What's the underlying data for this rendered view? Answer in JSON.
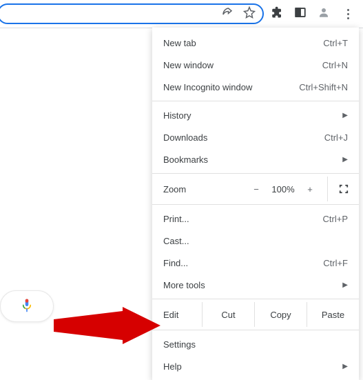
{
  "toolbar": {
    "share_icon": "share-icon",
    "star_icon": "star-icon",
    "ext_icon": "extensions-icon",
    "panel_icon": "side-panel-icon",
    "profile_icon": "profile-icon",
    "menu_icon": "kebab-menu-icon"
  },
  "menu": {
    "newTab": {
      "label": "New tab",
      "shortcut": "Ctrl+T"
    },
    "newWindow": {
      "label": "New window",
      "shortcut": "Ctrl+N"
    },
    "incognito": {
      "label": "New Incognito window",
      "shortcut": "Ctrl+Shift+N"
    },
    "history": {
      "label": "History"
    },
    "downloads": {
      "label": "Downloads",
      "shortcut": "Ctrl+J"
    },
    "bookmarks": {
      "label": "Bookmarks"
    },
    "zoom": {
      "label": "Zoom",
      "minus": "−",
      "value": "100%",
      "plus": "+"
    },
    "print": {
      "label": "Print...",
      "shortcut": "Ctrl+P"
    },
    "cast": {
      "label": "Cast..."
    },
    "find": {
      "label": "Find...",
      "shortcut": "Ctrl+F"
    },
    "moreTools": {
      "label": "More tools"
    },
    "edit": {
      "label": "Edit",
      "cut": "Cut",
      "copy": "Copy",
      "paste": "Paste"
    },
    "settings": {
      "label": "Settings"
    },
    "help": {
      "label": "Help"
    }
  }
}
